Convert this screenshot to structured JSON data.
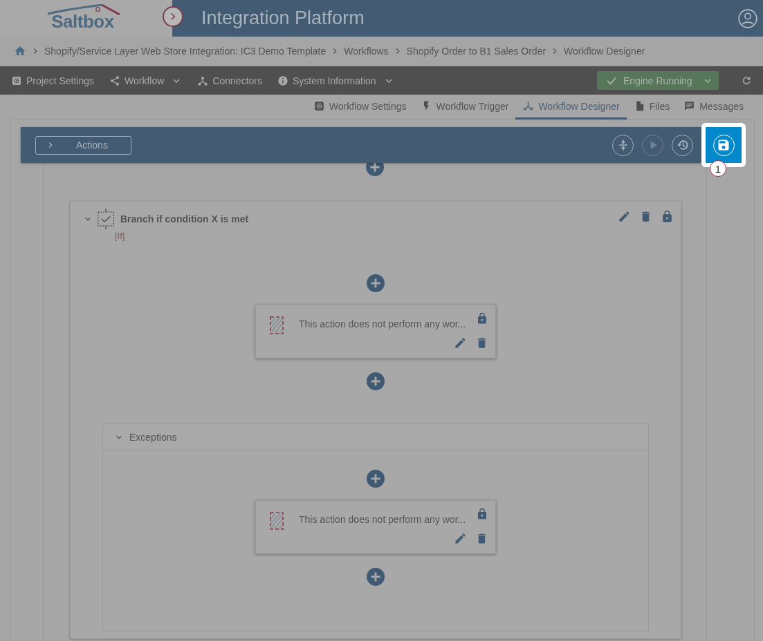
{
  "header": {
    "logo": "Saltbox",
    "title": "Integration Platform"
  },
  "breadcrumb": [
    "Shopify/Service Layer Web Store Integration: IC3 Demo Template",
    "Workflows",
    "Shopify Order to B1 Sales Order",
    "Workflow Designer"
  ],
  "menu": [
    {
      "label": "Project Settings",
      "kind": "gear",
      "dropdown": false
    },
    {
      "label": "Workflow",
      "kind": "share",
      "dropdown": true
    },
    {
      "label": "Connectors",
      "kind": "nodes",
      "dropdown": false
    },
    {
      "label": "System Information",
      "kind": "info",
      "dropdown": true
    }
  ],
  "engine_status": {
    "label": "Engine Running",
    "running": true
  },
  "tabs": [
    {
      "label": "Workflow Settings",
      "kind": "gear",
      "selected": false
    },
    {
      "label": "Workflow Trigger",
      "kind": "bolt",
      "selected": false
    },
    {
      "label": "Workflow Designer",
      "kind": "fork",
      "selected": true
    },
    {
      "label": "Files",
      "kind": "file",
      "selected": false
    },
    {
      "label": "Messages",
      "kind": "message",
      "selected": false
    }
  ],
  "action_bar": {
    "toggle_label": "Actions",
    "buttons": [
      {
        "kind": "collapse",
        "disabled": false,
        "highlighted": false
      },
      {
        "kind": "run",
        "disabled": true,
        "highlighted": false
      },
      {
        "kind": "history",
        "disabled": false,
        "highlighted": false
      },
      {
        "kind": "save",
        "disabled": false,
        "highlighted": true
      }
    ],
    "step_badge": "1"
  },
  "branch": {
    "title": "Branch if condition X is met",
    "tag": "[If]",
    "expanded": true,
    "actions": [
      {
        "text": "This action does not perform any wor..."
      }
    ],
    "exceptions": {
      "label": "Exceptions",
      "expanded": true,
      "actions": [
        {
          "text": "This action does not perform any wor..."
        }
      ]
    }
  }
}
